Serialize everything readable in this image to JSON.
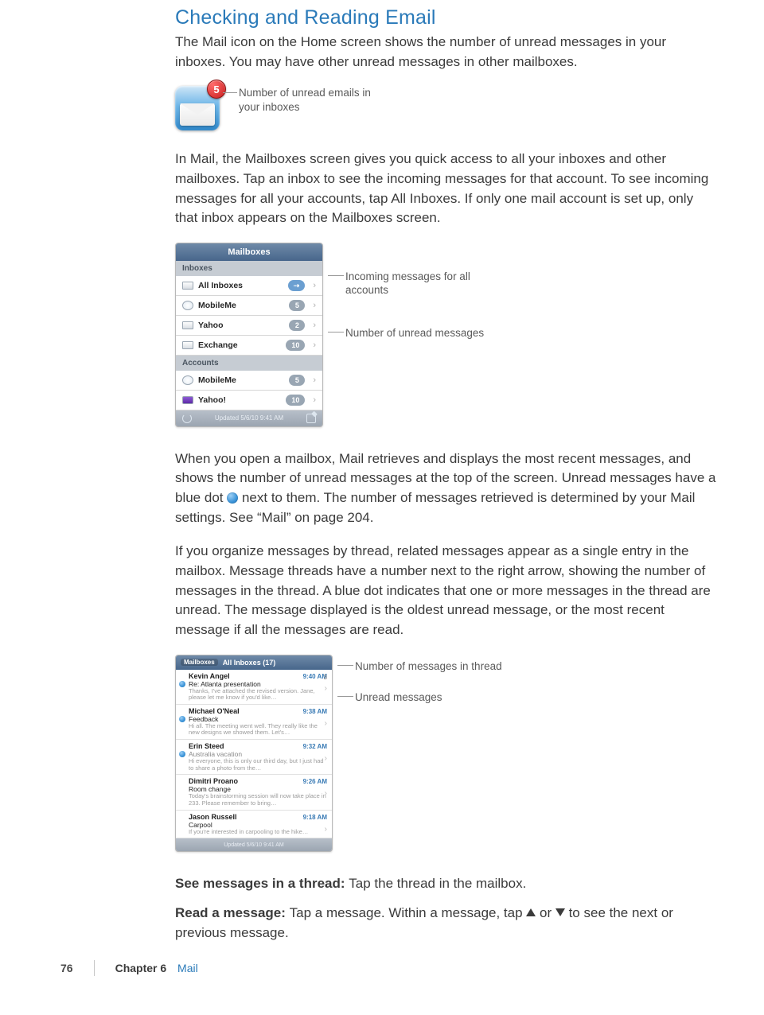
{
  "title": "Checking and Reading Email",
  "para1": "The Mail icon on the Home screen shows the number of unread messages in your inboxes. You may have other unread messages in other mailboxes.",
  "icon_badge": "5",
  "callout_icon": "Number of unread emails in your inboxes",
  "para2": "In Mail, the Mailboxes screen gives you quick access to all your inboxes and other mailboxes. Tap an inbox to see the incoming messages for that account. To see incoming messages for all your accounts, tap All Inboxes. If only one mail account is set up, only that inbox appears on the Mailboxes screen.",
  "mailboxes": {
    "header": "Mailboxes",
    "section1": "Inboxes",
    "rows1": [
      {
        "label": "All Inboxes",
        "count": "",
        "chev": "›"
      },
      {
        "label": "MobileMe",
        "count": "5",
        "chev": "›"
      },
      {
        "label": "Yahoo",
        "count": "2",
        "chev": "›"
      },
      {
        "label": "Exchange",
        "count": "10",
        "chev": "›"
      }
    ],
    "section2": "Accounts",
    "rows2": [
      {
        "label": "MobileMe",
        "count": "5",
        "chev": "›"
      },
      {
        "label": "Yahoo!",
        "count": "10",
        "chev": "›"
      }
    ],
    "footer_text": "Updated 5/6/10 9:41 AM"
  },
  "callout_mb_1": "Incoming messages for all accounts",
  "callout_mb_2": "Number of unread messages",
  "para3a": "When you open a mailbox, Mail retrieves and displays the most recent messages, and shows the number of unread messages at the top of the screen. Unread messages have a blue dot ",
  "para3b": " next to them. The number of messages retrieved is determined by your Mail settings. See “Mail” on page 204.",
  "para4": "If you organize messages by thread, related messages appear as a single entry in the mailbox. Message threads have a number next to the right arrow, showing the number of messages in the thread. A blue dot indicates that one or more messages in the thread are unread. The message displayed is the oldest unread message, or the most recent message if all the messages are read.",
  "inbox": {
    "back": "Mailboxes",
    "title": "All Inboxes (17)",
    "rows": [
      {
        "dot": true,
        "sender": "Kevin Angel",
        "clip": true,
        "time": "9:40 AM",
        "subj": "Re: Atlanta presentation",
        "subj_gray": false,
        "prev": "Thanks, I've attached the revised version. Jane, please let me know if you'd like…",
        "thread": "3"
      },
      {
        "dot": true,
        "sender": "Michael O'Neal",
        "clip": true,
        "time": "9:38 AM",
        "subj": "Feedback",
        "subj_gray": false,
        "prev": "Hi all. The meeting went well. They really like the new designs we showed them. Let's…",
        "thread": ""
      },
      {
        "dot": true,
        "sender": "Erin Steed",
        "clip": false,
        "time": "9:32 AM",
        "subj": "Australia vacation",
        "subj_gray": true,
        "prev": "Hi everyone, this is only our third day, but I just had to share a photo from the…",
        "thread": ""
      },
      {
        "dot": false,
        "sender": "Dimitri Proano",
        "clip": false,
        "time": "9:26 AM",
        "subj": "Room change",
        "subj_gray": false,
        "prev": "Today's brainstorming session will now take place in 233. Please remember to bring…",
        "thread": ""
      },
      {
        "dot": false,
        "sender": "Jason Russell",
        "clip": false,
        "time": "9:18 AM",
        "subj": "Carpool",
        "subj_gray": false,
        "prev": "If you're interested in carpooling to the hike…",
        "thread": ""
      }
    ],
    "footer_text": "Updated 5/6/10 9:41 AM"
  },
  "callout_ib_1": "Number of messages in thread",
  "callout_ib_2": "Unread messages",
  "see_messages_lead": "See messages in a thread:  ",
  "see_messages_rest": "Tap the thread in the mailbox.",
  "read_message_lead": "Read a message:  ",
  "read_message_a": "Tap a message. Within a message, tap ",
  "read_message_mid": " or ",
  "read_message_b": " to see the next or previous message.",
  "footer": {
    "page": "76",
    "chapter": "Chapter 6",
    "name": "Mail"
  }
}
